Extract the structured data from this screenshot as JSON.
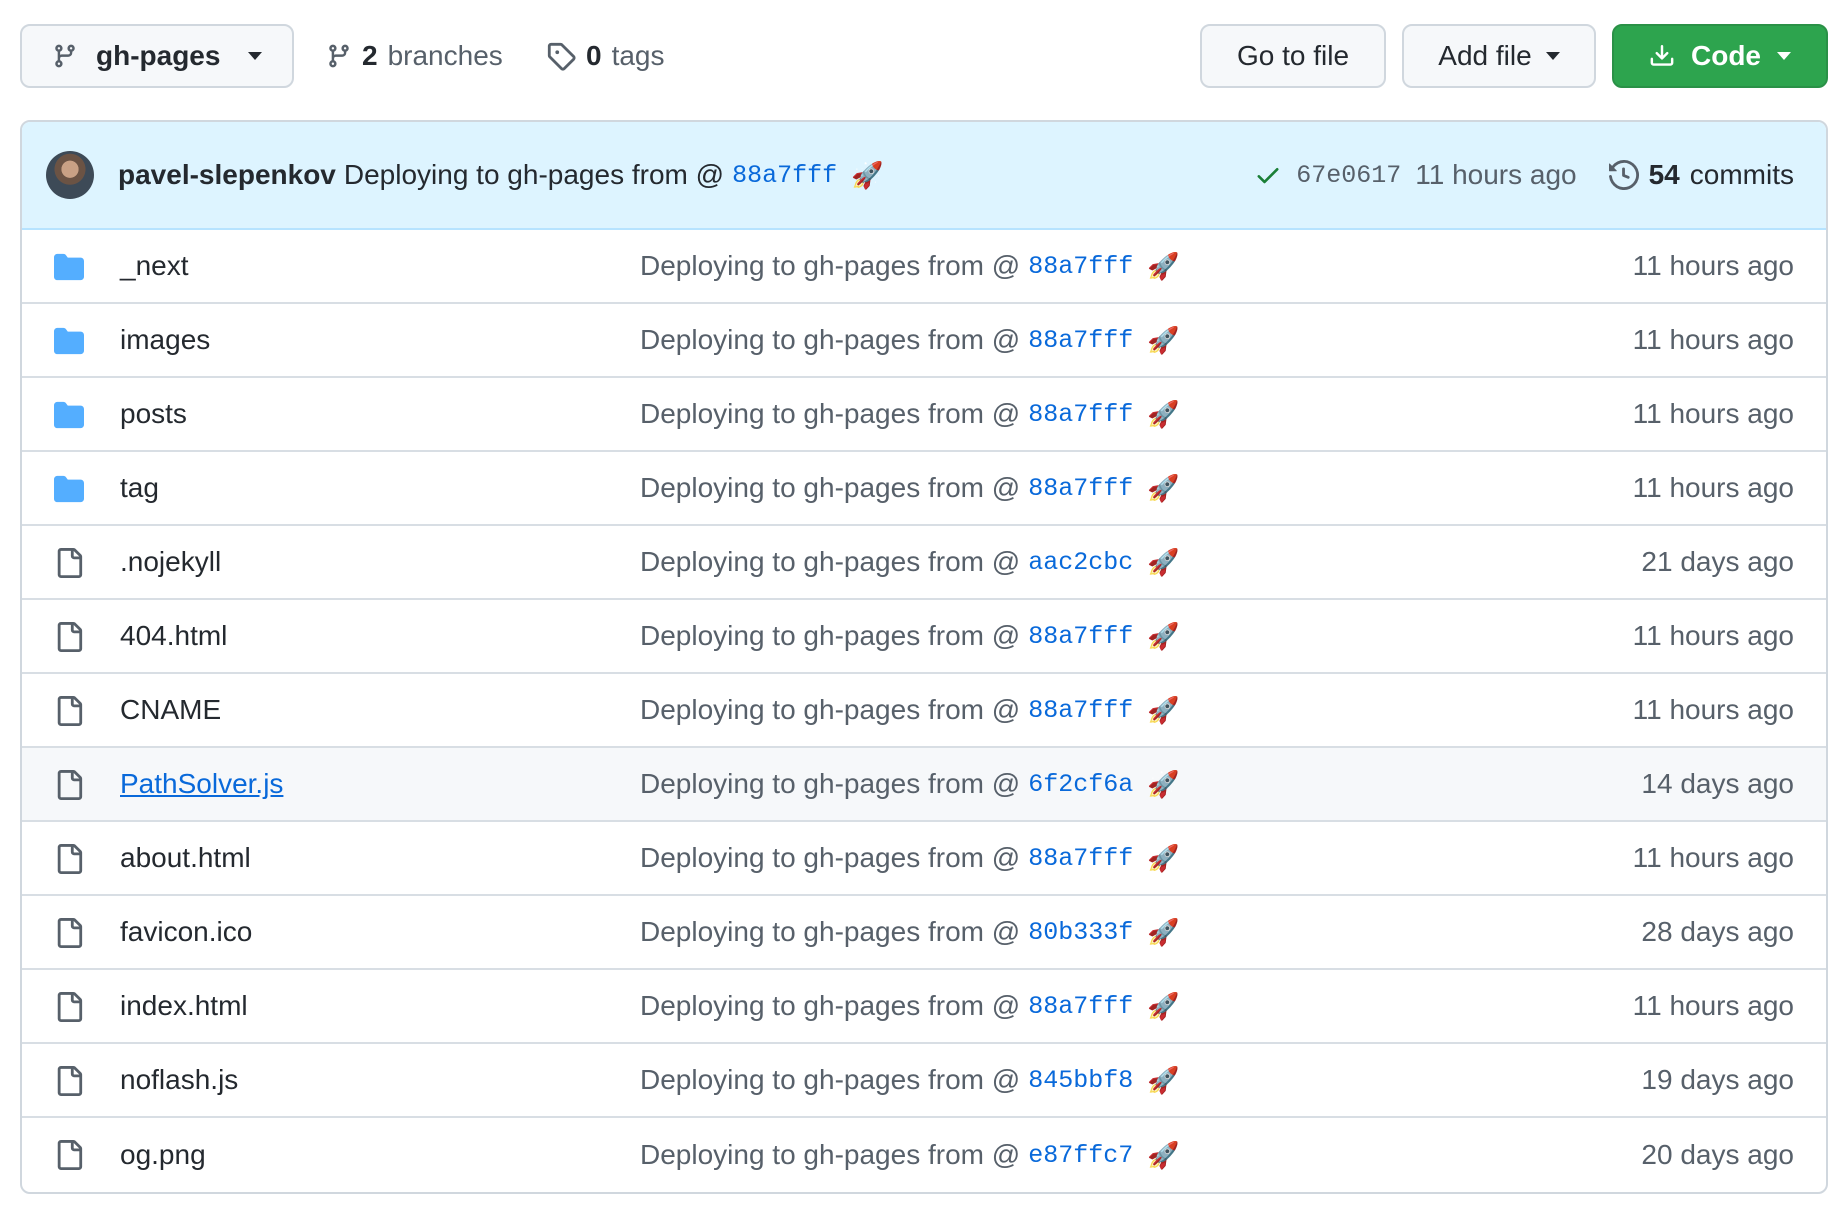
{
  "toolbar": {
    "branch_label": "gh-pages",
    "branches_count": "2",
    "branches_label": "branches",
    "tags_count": "0",
    "tags_label": "tags",
    "go_to_file": "Go to file",
    "add_file": "Add file",
    "code": "Code"
  },
  "latest_commit": {
    "author": "pavel-slepenkov",
    "message": "Deploying to gh-pages from @",
    "message_sha": "88a7fff",
    "emoji": "🚀",
    "commit_sha": "67e0617",
    "age": "11 hours ago",
    "commits_count": "54",
    "commits_label": "commits",
    "status": "success"
  },
  "colors": {
    "primary_button": "#2da44e",
    "link": "#0969da",
    "folder": "#54aeff",
    "header_bg": "#ddf4ff",
    "success": "#1a7f37"
  },
  "files": [
    {
      "type": "folder",
      "name": "_next",
      "message": "Deploying to gh-pages from @",
      "sha": "88a7fff",
      "emoji": "🚀",
      "age": "11 hours ago"
    },
    {
      "type": "folder",
      "name": "images",
      "message": "Deploying to gh-pages from @",
      "sha": "88a7fff",
      "emoji": "🚀",
      "age": "11 hours ago"
    },
    {
      "type": "folder",
      "name": "posts",
      "message": "Deploying to gh-pages from @",
      "sha": "88a7fff",
      "emoji": "🚀",
      "age": "11 hours ago"
    },
    {
      "type": "folder",
      "name": "tag",
      "message": "Deploying to gh-pages from @",
      "sha": "88a7fff",
      "emoji": "🚀",
      "age": "11 hours ago"
    },
    {
      "type": "file",
      "name": ".nojekyll",
      "message": "Deploying to gh-pages from @",
      "sha": "aac2cbc",
      "emoji": "🚀",
      "age": "21 days ago"
    },
    {
      "type": "file",
      "name": "404.html",
      "message": "Deploying to gh-pages from @",
      "sha": "88a7fff",
      "emoji": "🚀",
      "age": "11 hours ago"
    },
    {
      "type": "file",
      "name": "CNAME",
      "message": "Deploying to gh-pages from @",
      "sha": "88a7fff",
      "emoji": "🚀",
      "age": "11 hours ago"
    },
    {
      "type": "file",
      "name": "PathSolver.js",
      "message": "Deploying to gh-pages from @",
      "sha": "6f2cf6a",
      "emoji": "🚀",
      "age": "14 days ago",
      "hovered": true
    },
    {
      "type": "file",
      "name": "about.html",
      "message": "Deploying to gh-pages from @",
      "sha": "88a7fff",
      "emoji": "🚀",
      "age": "11 hours ago"
    },
    {
      "type": "file",
      "name": "favicon.ico",
      "message": "Deploying to gh-pages from @",
      "sha": "80b333f",
      "emoji": "🚀",
      "age": "28 days ago"
    },
    {
      "type": "file",
      "name": "index.html",
      "message": "Deploying to gh-pages from @",
      "sha": "88a7fff",
      "emoji": "🚀",
      "age": "11 hours ago"
    },
    {
      "type": "file",
      "name": "noflash.js",
      "message": "Deploying to gh-pages from @",
      "sha": "845bbf8",
      "emoji": "🚀",
      "age": "19 days ago"
    },
    {
      "type": "file",
      "name": "og.png",
      "message": "Deploying to gh-pages from @",
      "sha": "e87ffc7",
      "emoji": "🚀",
      "age": "20 days ago"
    }
  ]
}
